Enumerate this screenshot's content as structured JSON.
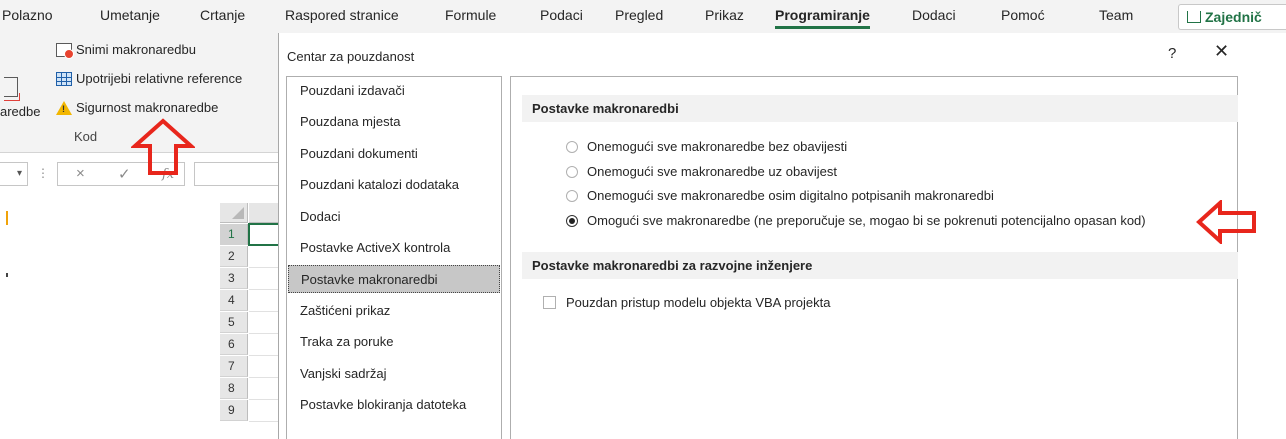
{
  "ribbon_tabs": [
    {
      "label": "Polazno",
      "active": false
    },
    {
      "label": "Umetanje",
      "active": false
    },
    {
      "label": "Crtanje",
      "active": false
    },
    {
      "label": "Raspored stranice",
      "active": false
    },
    {
      "label": "Formule",
      "active": false
    },
    {
      "label": "Podaci",
      "active": false
    },
    {
      "label": "Pregled",
      "active": false
    },
    {
      "label": "Prikaz",
      "active": false
    },
    {
      "label": "Programiranje",
      "active": true
    },
    {
      "label": "Dodaci",
      "active": false
    },
    {
      "label": "Pomoć",
      "active": false
    },
    {
      "label": "Team",
      "active": false
    }
  ],
  "share_button": {
    "label": "Zajednič",
    "icon": "share-icon"
  },
  "ribbon": {
    "left_button_label": "aredbe",
    "record_macro": "Snimi makronaredbu",
    "relative_references": "Upotrijebi relativne reference",
    "macro_security": "Sigurnost makronaredbe",
    "group_label": "Kod"
  },
  "formula_bar": {
    "cancel_icon": "×",
    "enter_icon": "✓",
    "function_icon": "fx",
    "separator": "⋮",
    "dropdown_icon": "▾"
  },
  "sheet": {
    "row_headers": [
      "1",
      "2",
      "3",
      "4",
      "5",
      "6",
      "7",
      "8",
      "9"
    ]
  },
  "dialog": {
    "title": "Centar za pouzdanost",
    "help": "?",
    "close": "✕",
    "nav_items": [
      {
        "label": "Pouzdani izdavači",
        "selected": false
      },
      {
        "label": "Pouzdana mjesta",
        "selected": false
      },
      {
        "label": "Pouzdani dokumenti",
        "selected": false
      },
      {
        "label": "Pouzdani katalozi dodataka",
        "selected": false
      },
      {
        "label": "Dodaci",
        "selected": false
      },
      {
        "label": "Postavke ActiveX kontrola",
        "selected": false
      },
      {
        "label": "Postavke makronaredbi",
        "selected": true
      },
      {
        "label": "Zaštićeni prikaz",
        "selected": false
      },
      {
        "label": "Traka za poruke",
        "selected": false
      },
      {
        "label": "Vanjski sadržaj",
        "selected": false
      },
      {
        "label": "Postavke blokiranja datoteka",
        "selected": false
      }
    ],
    "macro_settings_header": "Postavke makronaredbi",
    "macro_options": [
      {
        "label": "Onemogući sve makronaredbe bez obavijesti",
        "selected": false
      },
      {
        "label": "Onemogući sve makronaredbe uz obavijest",
        "selected": false
      },
      {
        "label": "Onemogući sve makronaredbe osim digitalno potpisanih makronaredbi",
        "selected": false
      },
      {
        "label": "Omogući sve makronaredbe (ne preporučuje se, mogao bi se pokrenuti potencijalno opasan kod)",
        "selected": true
      }
    ],
    "developer_header": "Postavke makronaredbi za razvojne inženjere",
    "vba_access": {
      "label": "Pouzdan pristup modelu objekta VBA projekta",
      "checked": false
    }
  },
  "colors": {
    "accent": "#217346",
    "annotation_red": "#e8261c",
    "ribbon_bg": "#f3f3f3",
    "selected_nav": "#c7c7c7"
  }
}
